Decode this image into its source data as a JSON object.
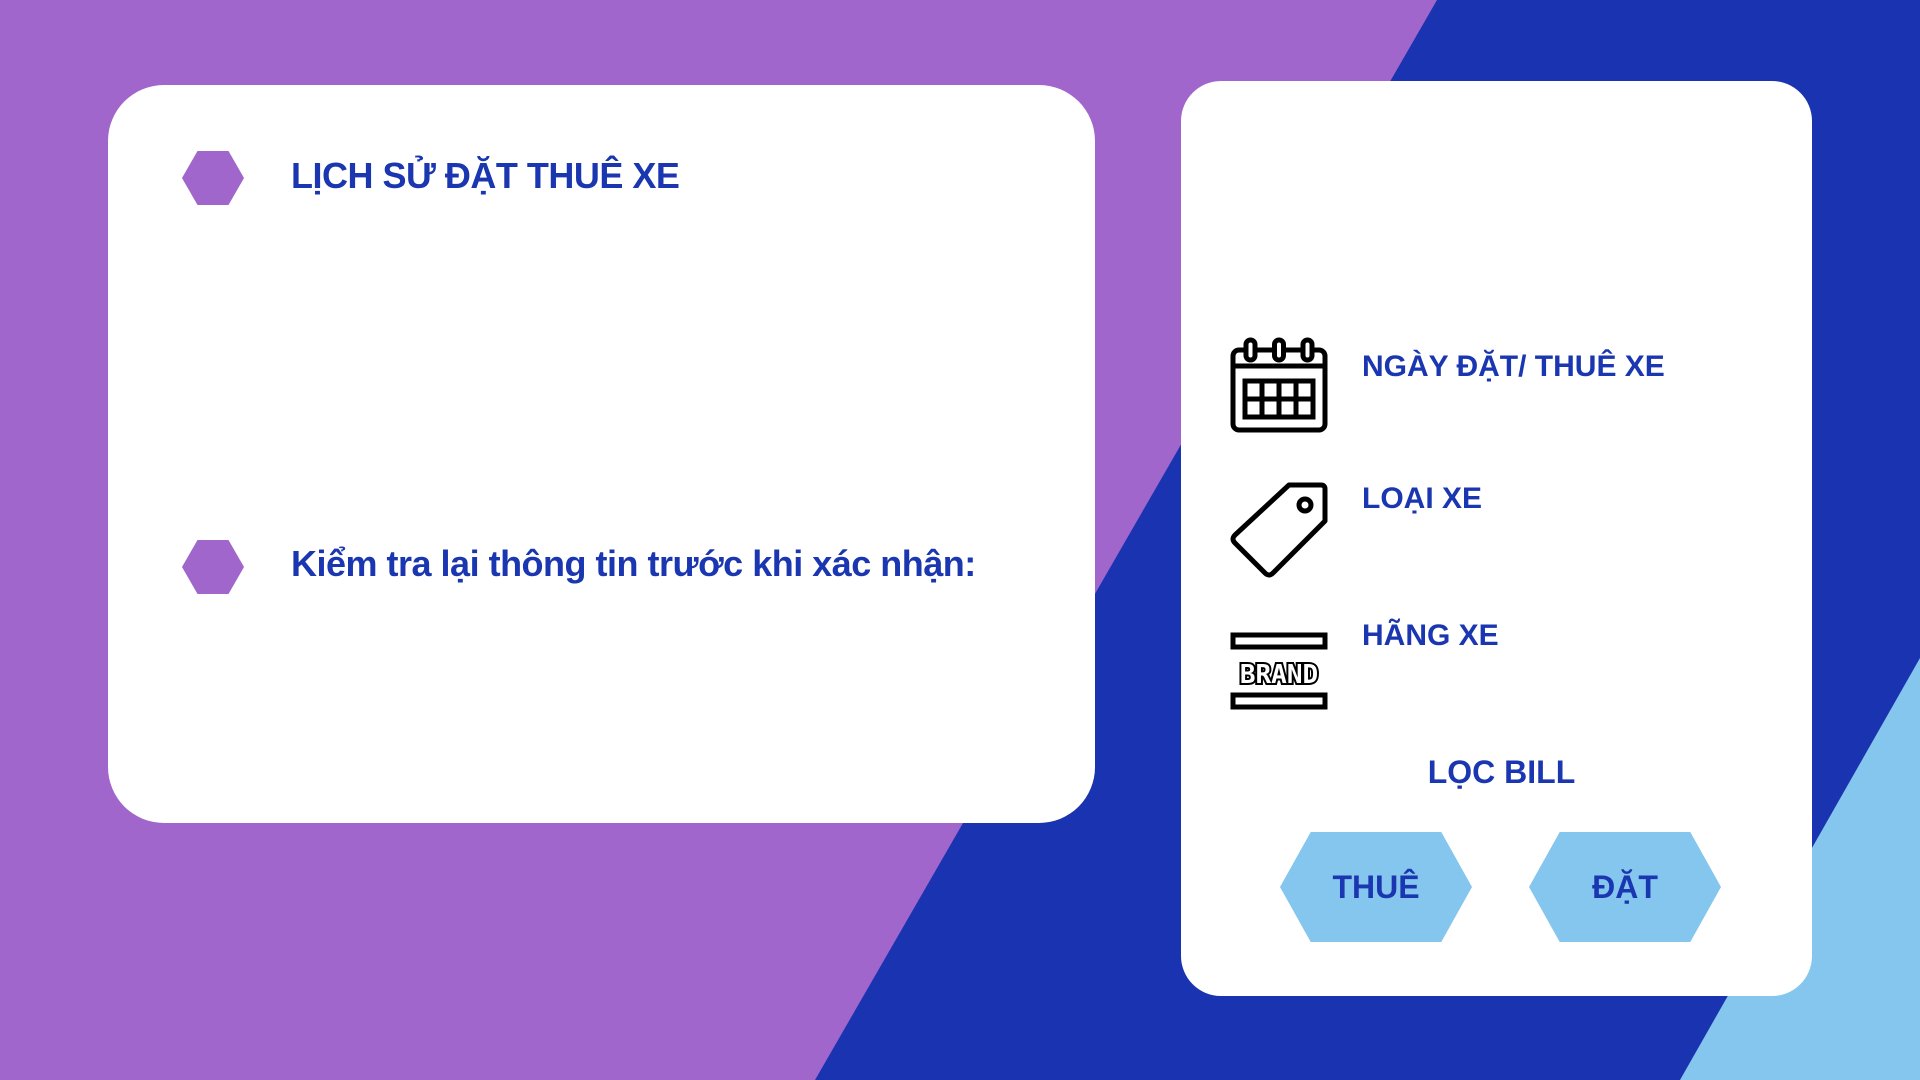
{
  "colors": {
    "background_purple": "#a066cc",
    "background_dark_blue": "#1a33b0",
    "background_light_blue": "#85c6ee",
    "card_white": "#ffffff",
    "text_blue": "#1a36b0",
    "bullet_purple": "#a066cc",
    "button_light_blue": "#85c6ee"
  },
  "left_panel": {
    "title": "LỊCH SỬ ĐẶT THUÊ XE",
    "check_text": "Kiểm tra lại thông tin trước khi xác nhận:"
  },
  "filter_panel": {
    "items": [
      {
        "icon": "calendar-icon",
        "label": "NGÀY ĐẶT/ THUÊ XE"
      },
      {
        "icon": "price-tag-icon",
        "label": "LOẠI XE"
      },
      {
        "icon": "brand-icon",
        "label": "HÃNG XE",
        "icon_text": "BRAND"
      }
    ],
    "filter_title": "LỌC BILL",
    "buttons": [
      {
        "label": "THUÊ"
      },
      {
        "label": "ĐẶT"
      }
    ]
  }
}
